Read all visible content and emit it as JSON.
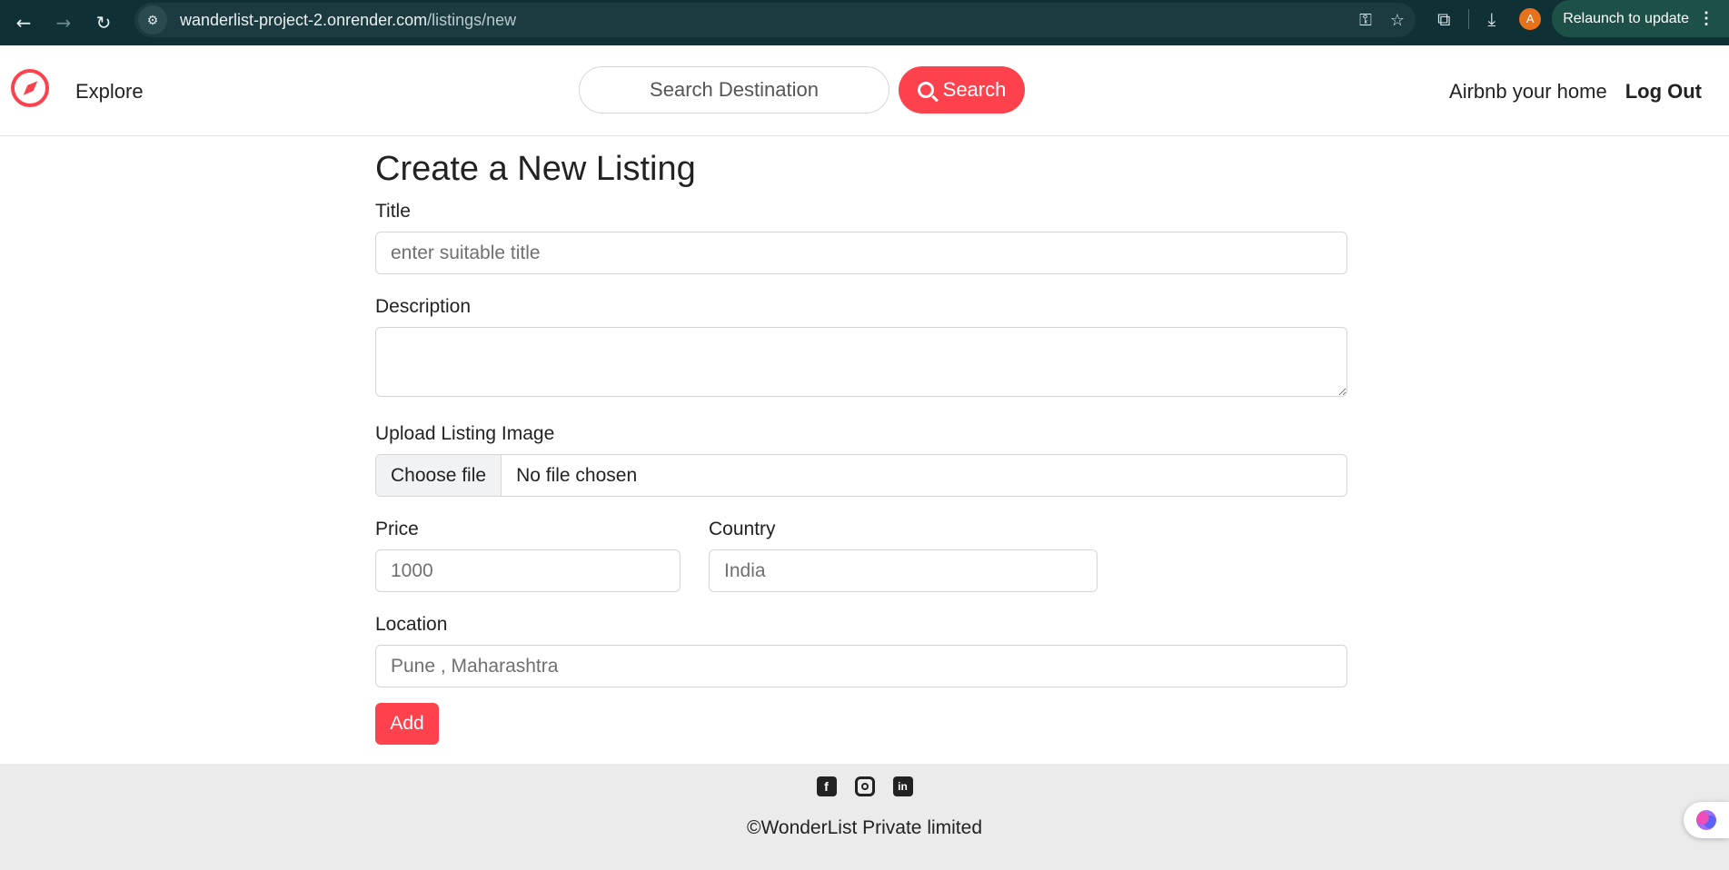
{
  "browser": {
    "url_host": "wanderlist-project-2.onrender.com",
    "url_path": "/listings/new",
    "back_icon": "←",
    "forward_icon": "→",
    "reload_icon": "↻",
    "site_info_icon": "⚙",
    "key_icon": "⚿",
    "star_icon": "☆",
    "extensions_icon": "⧉",
    "download_icon": "⤓",
    "profile_initial": "A",
    "relaunch_label": "Relaunch to update",
    "menu_icon": "⋮"
  },
  "navbar": {
    "explore_label": "Explore",
    "search_placeholder": "Search Destination",
    "search_button_label": "Search",
    "host_link_label": "Airbnb your home",
    "logout_label": "Log Out",
    "accent_color": "#fe424d"
  },
  "form": {
    "heading": "Create a New Listing",
    "title_label": "Title",
    "title_placeholder": "enter suitable title",
    "description_label": "Description",
    "image_label": "Upload Listing Image",
    "file_button_label": "Choose file",
    "file_status": "No file chosen",
    "price_label": "Price",
    "price_placeholder": "1000",
    "country_label": "Country",
    "country_placeholder": "India",
    "location_label": "Location",
    "location_placeholder": "Pune , Maharashtra",
    "submit_label": "Add"
  },
  "footer": {
    "facebook_glyph": "f",
    "linkedin_glyph": "in",
    "copyright": "©WonderList Private limited"
  }
}
